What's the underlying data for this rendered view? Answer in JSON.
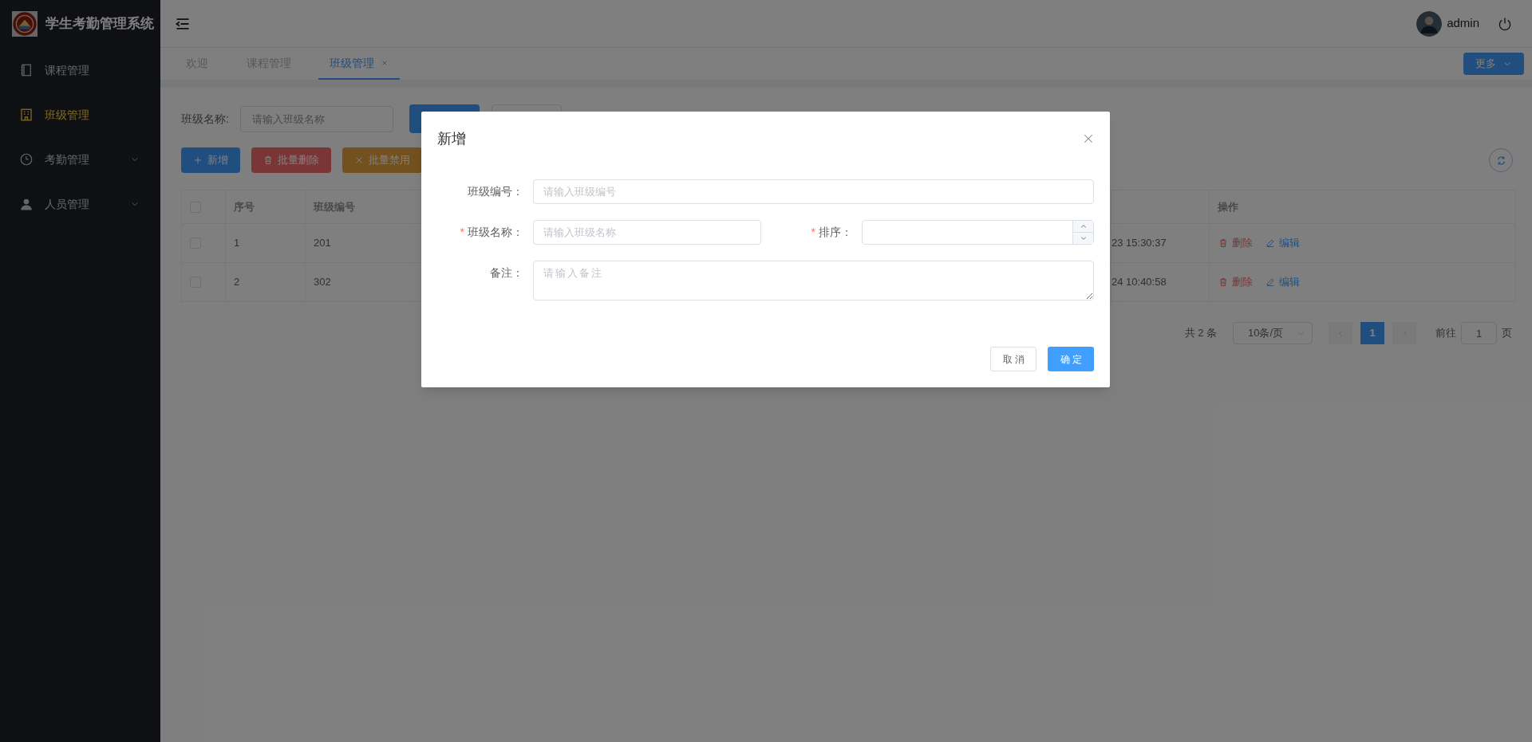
{
  "app": {
    "title": "学生考勤管理系统"
  },
  "sidebar": {
    "items": [
      {
        "label": "课程管理",
        "kind": "book",
        "selected": false
      },
      {
        "label": "班级管理",
        "kind": "building",
        "selected": true
      },
      {
        "label": "考勤管理",
        "kind": "clock",
        "selected": false,
        "expandable": true
      },
      {
        "label": "人员管理",
        "kind": "person",
        "selected": false,
        "expandable": true
      }
    ]
  },
  "header": {
    "user": "admin"
  },
  "tabs": [
    {
      "label": "欢迎",
      "selected": false,
      "closable": false
    },
    {
      "label": "课程管理",
      "selected": false,
      "closable": false
    },
    {
      "label": "班级管理",
      "selected": true,
      "closable": true
    }
  ],
  "more_button": "更多",
  "search": {
    "label": "班级名称:",
    "placeholder": "请输入班级名称"
  },
  "toolbar": [
    {
      "label": "新增",
      "kind": "add"
    },
    {
      "label": "批量删除",
      "kind": "delete"
    },
    {
      "label": "批量禁用",
      "kind": "disable"
    }
  ],
  "table": {
    "header_checked": false,
    "columns": [
      "序号",
      "班级编号",
      "操作"
    ],
    "rows": [
      {
        "checked": false,
        "index": "1",
        "code": "201",
        "column_4": "23 15:30:37",
        "actions": [
          {
            "label": "删除",
            "kind": "delete"
          },
          {
            "label": "编辑",
            "kind": "edit"
          }
        ]
      },
      {
        "checked": false,
        "index": "2",
        "code": "302",
        "column_4": "24 10:40:58",
        "actions": [
          {
            "label": "删除",
            "kind": "delete"
          },
          {
            "label": "编辑",
            "kind": "edit"
          }
        ]
      }
    ]
  },
  "pagination": {
    "total": "共 2 条",
    "page_size": "10条/页",
    "pages": [
      {
        "label": "1",
        "selected": true
      }
    ],
    "goto_label": "前往",
    "goto_value": "1",
    "goto_suffix": "页"
  },
  "dialog": {
    "title": "新增",
    "required_mark": "*",
    "rows": [
      [
        {
          "label": "班级编号：",
          "placeholder": "请输入班级编号",
          "required": false,
          "kind": "text"
        }
      ],
      [
        {
          "label": "班级名称：",
          "placeholder": "请输入班级名称",
          "required": true,
          "kind": "text"
        },
        {
          "label": "排序：",
          "required": true,
          "kind": "number"
        }
      ],
      [
        {
          "label": "备注：",
          "placeholder": "请输入备注",
          "required": false,
          "kind": "textarea"
        }
      ]
    ],
    "buttons": [
      {
        "label": "取消",
        "kind": "default"
      },
      {
        "label": "确定",
        "kind": "primary"
      }
    ]
  }
}
